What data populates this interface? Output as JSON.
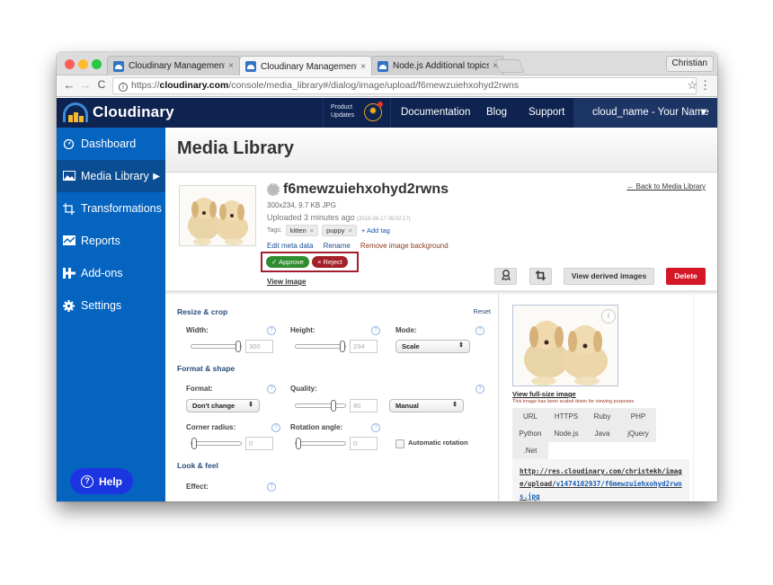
{
  "browser": {
    "tabs": [
      {
        "title": "Cloudinary Management Cons",
        "active": false
      },
      {
        "title": "Cloudinary Management Cons",
        "active": true
      },
      {
        "title": "Node.js Additional topics | Clo",
        "active": false
      }
    ],
    "tab_close": "×",
    "profile": "Christian",
    "url_prefix": "https://",
    "url_domain": "cloudinary.com",
    "url_path": "/console/media_library#/dialog/image/upload/f6mewzuiehxohyd2rwns",
    "back": "←",
    "forward": "→",
    "reload": "C",
    "star": "☆",
    "menu": "⋮"
  },
  "header": {
    "brand": "Cloudinary",
    "product_updates": [
      "Product",
      "Updates"
    ],
    "nav": [
      "Documentation",
      "Blog",
      "Support"
    ],
    "account": "cloud_name - Your Name",
    "account_caret": "▼"
  },
  "sidebar": {
    "items": [
      {
        "label": "Dashboard",
        "icon": "dashboard-icon"
      },
      {
        "label": "Media Library",
        "icon": "image-icon",
        "active": true
      },
      {
        "label": "Transformations",
        "icon": "crop-icon"
      },
      {
        "label": "Reports",
        "icon": "chart-icon"
      },
      {
        "label": "Add-ons",
        "icon": "addons-icon"
      },
      {
        "label": "Settings",
        "icon": "gear-icon"
      }
    ],
    "active_arrow": "▶",
    "help": "Help"
  },
  "page": {
    "title": "Media Library",
    "back_link": "← Back to Media Library"
  },
  "asset": {
    "public_id": "f6mewzuiehxohyd2rwns",
    "dimensions": "300x234, 9.7 KB JPG",
    "uploaded": "Uploaded 3 minutes ago",
    "timestamp": "(2016-09-17 09:02:17)",
    "tags_label": "Tags:",
    "tags": [
      "kitten",
      "puppy"
    ],
    "tag_remove": "×",
    "add_tag": "+ Add tag",
    "actions": [
      "Edit meta data",
      "Rename",
      "Remove image background"
    ],
    "approve": "✓ Approve",
    "reject": "× Reject",
    "view_image": "View image",
    "view_derived": "View derived images",
    "delete": "Delete"
  },
  "editor": {
    "resize_title": "Resize & crop",
    "reset": "Reset",
    "width_label": "Width:",
    "width_value": "300",
    "width_fraction": 1.0,
    "height_label": "Height:",
    "height_value": "234",
    "height_fraction": 1.0,
    "mode_label": "Mode:",
    "mode_value": "Scale",
    "format_title": "Format & shape",
    "format_label": "Format:",
    "format_value": "Don't change",
    "quality_label": "Quality:",
    "quality_value": "80",
    "quality_fraction": 0.8,
    "quality_mode": "Manual",
    "corner_label": "Corner radius:",
    "corner_value": "0",
    "rotation_label": "Rotation angle:",
    "rotation_value": "0",
    "auto_rotation": "Automatic rotation",
    "look_title": "Look & feel",
    "effect_label": "Effect:",
    "help_glyph": "?",
    "select_caret": "⇕"
  },
  "preview": {
    "view_full": "View full-size image",
    "note": "This image has been scaled down for viewing purposes",
    "code_tabs": [
      "URL",
      "HTTPS",
      "Ruby",
      "PHP",
      "Python",
      "Node.js",
      "Java",
      "jQuery",
      ".Net"
    ],
    "url_part1": "http://res.cloudinary.com/christekh/image/upload/",
    "url_part2": "v1474102937/f6mewzuiehxohyd2rwns.jpg"
  }
}
